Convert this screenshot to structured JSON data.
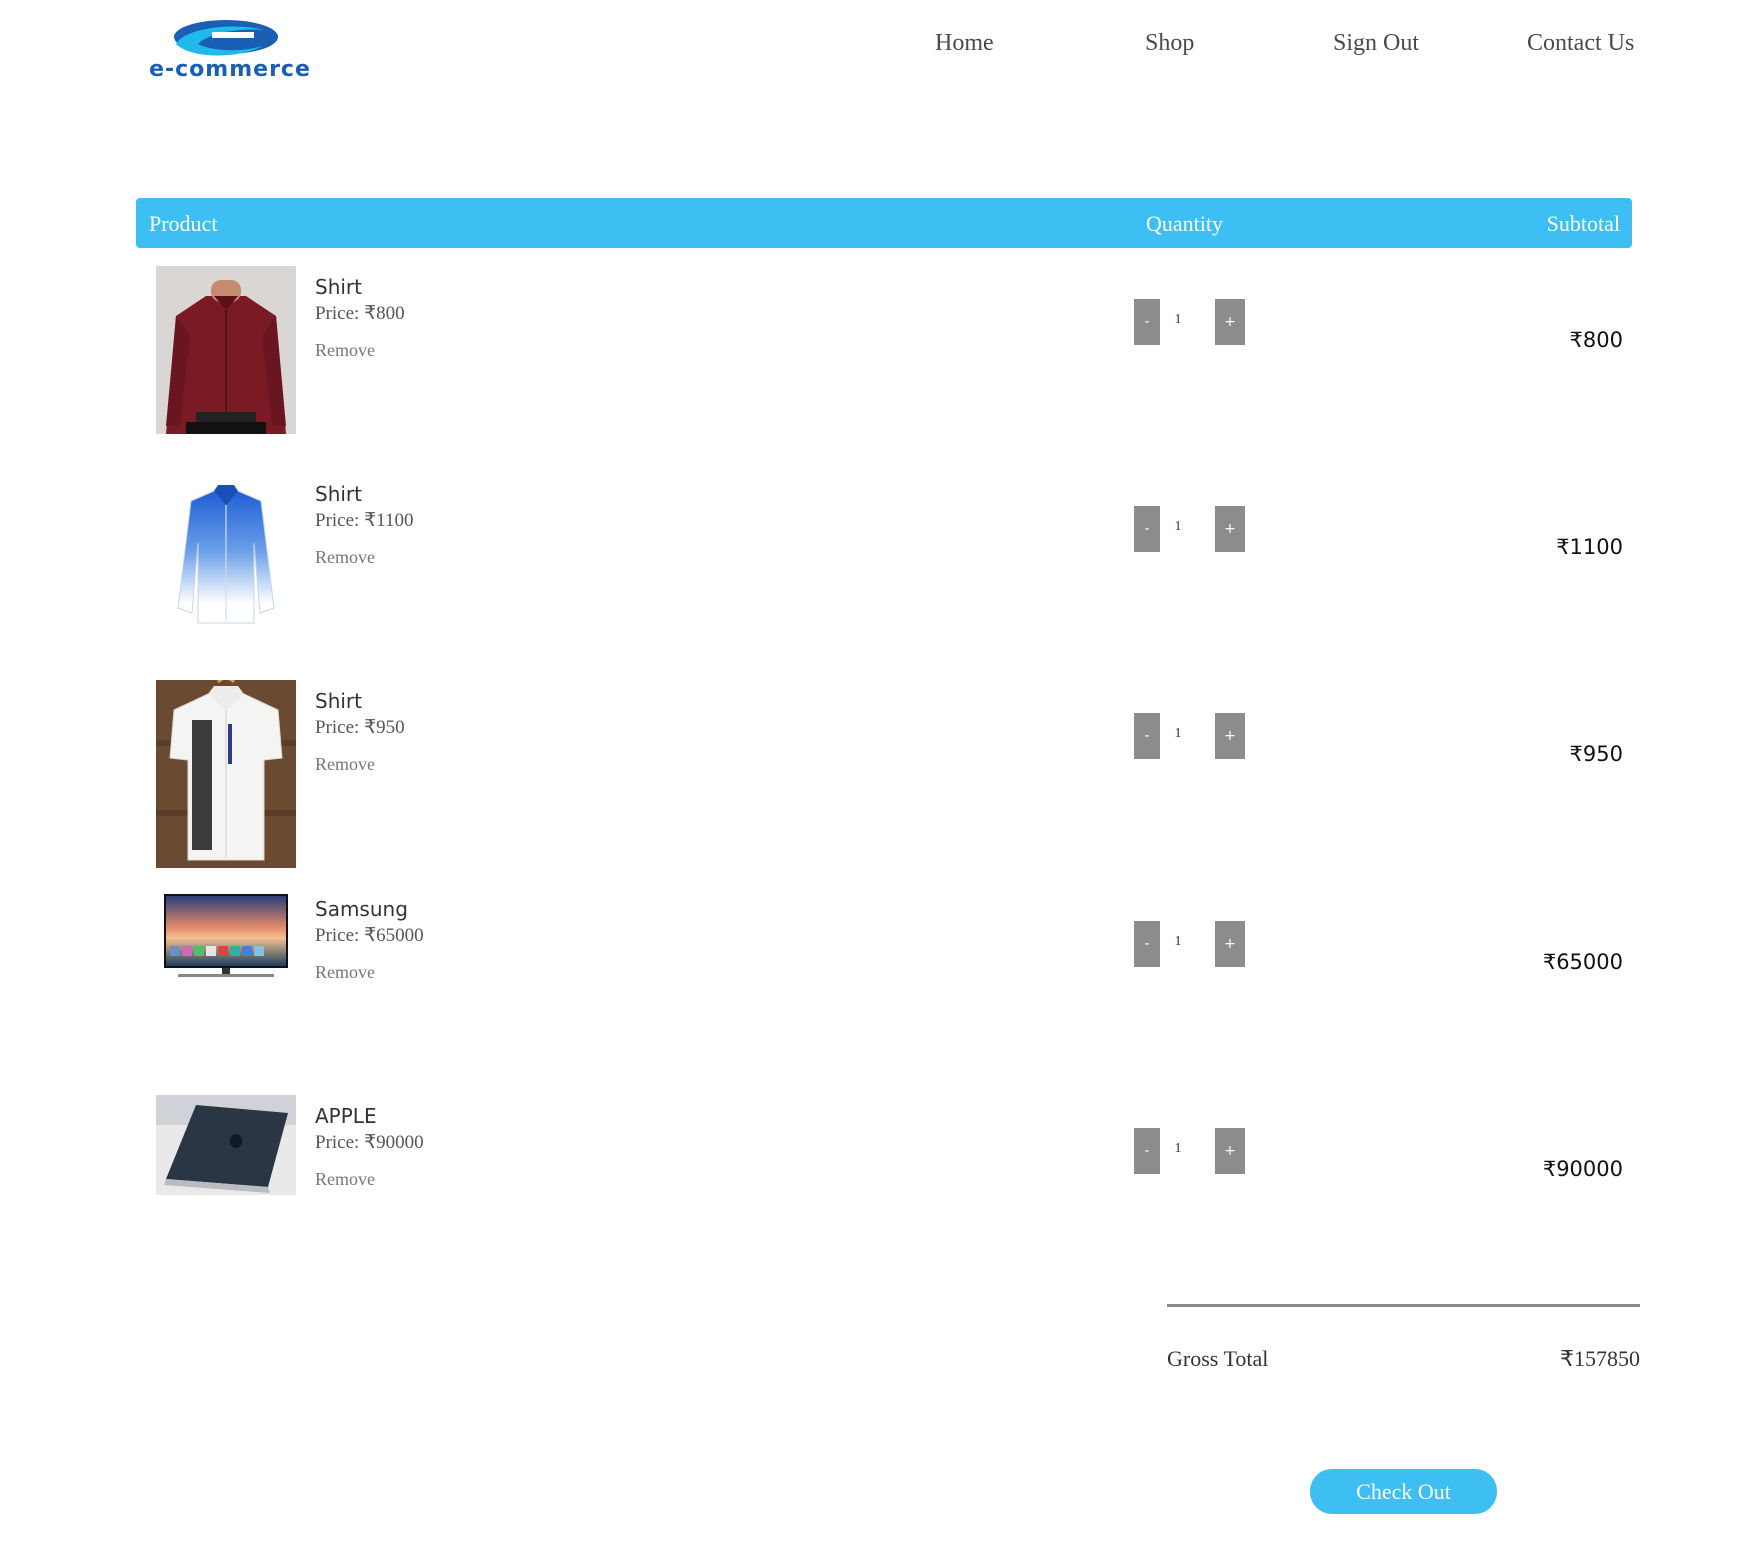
{
  "brand": {
    "logo_text": "e-commerce"
  },
  "nav": {
    "home": "Home",
    "shop": "Shop",
    "sign_out": "Sign Out",
    "contact": "Contact Us"
  },
  "table": {
    "headers": {
      "product": "Product",
      "quantity": "Quantity",
      "subtotal": "Subtotal"
    }
  },
  "controls": {
    "minus": "-",
    "plus": "+",
    "remove": "Remove"
  },
  "cart": [
    {
      "name": "Shirt",
      "price": "Price: ₹800",
      "quantity": "1",
      "subtotal": "₹800",
      "image": "maroon-shirt"
    },
    {
      "name": "Shirt",
      "price": "Price: ₹1100",
      "quantity": "1",
      "subtotal": "₹1100",
      "image": "blue-gradient-shirt"
    },
    {
      "name": "Shirt",
      "price": "Price: ₹950",
      "quantity": "1",
      "subtotal": "₹950",
      "image": "white-print-shirt"
    },
    {
      "name": "Samsung",
      "price": "Price: ₹65000",
      "quantity": "1",
      "subtotal": "₹65000",
      "image": "television"
    },
    {
      "name": "APPLE",
      "price": "Price: ₹90000",
      "quantity": "1",
      "subtotal": "₹90000",
      "image": "laptop"
    }
  ],
  "totals": {
    "gross_label": "Gross Total",
    "gross_value": "₹157850"
  },
  "checkout": {
    "label": "Check Out"
  },
  "colors": {
    "accent": "#3ebff4",
    "qty_button": "#8c8c8c",
    "logo_blue": "#1a5fb4"
  }
}
